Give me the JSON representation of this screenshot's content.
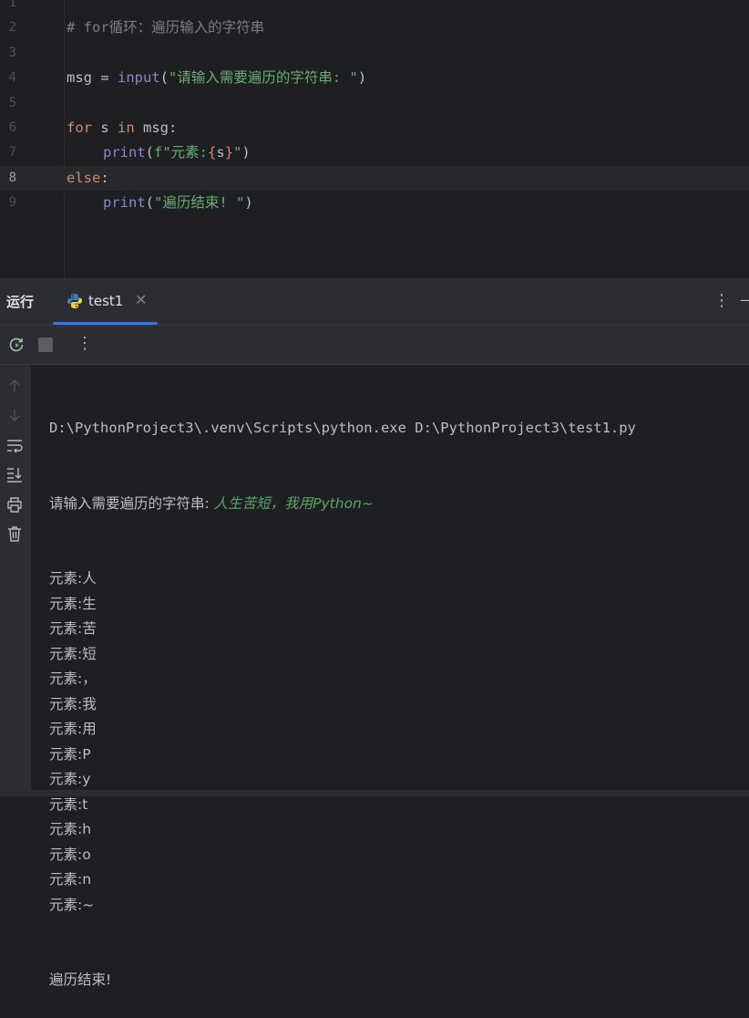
{
  "editor": {
    "lines": [
      {
        "num": "1",
        "tokens": []
      },
      {
        "num": "2",
        "tokens": [
          {
            "cls": "t-comment",
            "text": "# for循环：遍历输入的字符串"
          }
        ]
      },
      {
        "num": "3",
        "tokens": []
      },
      {
        "num": "4",
        "tokens": [
          {
            "cls": "t-plain",
            "text": "msg = "
          },
          {
            "cls": "t-builtin",
            "text": "input"
          },
          {
            "cls": "t-plain",
            "text": "("
          },
          {
            "cls": "t-str",
            "text": "\"请输入需要遍历的字符串: \""
          },
          {
            "cls": "t-plain",
            "text": ")"
          }
        ]
      },
      {
        "num": "5",
        "tokens": []
      },
      {
        "num": "6",
        "tokens": [
          {
            "cls": "t-kw",
            "text": "for"
          },
          {
            "cls": "t-plain",
            "text": " s "
          },
          {
            "cls": "t-kw",
            "text": "in"
          },
          {
            "cls": "t-plain",
            "text": " msg:"
          }
        ]
      },
      {
        "num": "7",
        "indent": true,
        "tokens": [
          {
            "cls": "t-builtin",
            "text": "print"
          },
          {
            "cls": "t-plain",
            "text": "("
          },
          {
            "cls": "t-str",
            "text": "f\"元素:"
          },
          {
            "cls": "t-brace",
            "text": "{"
          },
          {
            "cls": "t-plain",
            "text": "s"
          },
          {
            "cls": "t-brace",
            "text": "}"
          },
          {
            "cls": "t-str",
            "text": "\""
          },
          {
            "cls": "t-plain",
            "text": ")"
          }
        ]
      },
      {
        "num": "8",
        "current": true,
        "tokens": [
          {
            "cls": "t-kw",
            "text": "else"
          },
          {
            "cls": "t-plain",
            "text": ":"
          }
        ]
      },
      {
        "num": "9",
        "indent": true,
        "tokens": [
          {
            "cls": "t-builtin",
            "text": "print"
          },
          {
            "cls": "t-plain",
            "text": "("
          },
          {
            "cls": "t-str",
            "text": "\"遍历结束! \""
          },
          {
            "cls": "t-plain",
            "text": ")"
          }
        ]
      }
    ]
  },
  "run_panel": {
    "title": "运行",
    "tab_label": "test1",
    "tab_close": "✕",
    "more": "⋮",
    "minimize": "—"
  },
  "toolbar": {
    "more": "⋮"
  },
  "icons": {
    "rerun": "rerun-icon",
    "stop": "stop-icon",
    "scroll_up": "arrow-up-icon",
    "scroll_down": "arrow-down-icon",
    "soft_wrap": "soft-wrap-icon",
    "scroll_to_end": "scroll-to-end-icon",
    "print": "print-icon",
    "clear": "trash-icon"
  },
  "console": {
    "command": "D:\\PythonProject3\\.venv\\Scripts\\python.exe D:\\PythonProject3\\test1.py",
    "prompt": "请输入需要遍历的字符串: ",
    "user_input": "人生苦短，我用Python~",
    "outputs": [
      "元素:人",
      "元素:生",
      "元素:苦",
      "元素:短",
      "元素:，",
      "元素:我",
      "元素:用",
      "元素:P",
      "元素:y",
      "元素:t",
      "元素:h",
      "元素:o",
      "元素:n",
      "元素:~"
    ],
    "end": "遍历结束!"
  },
  "colors": {
    "background": "#1e1f22",
    "panel": "#2b2d30",
    "accent": "#3574f0",
    "keyword": "#cf8e6d",
    "string": "#6aab73",
    "builtin": "#8888c6",
    "comment": "#7a7e85"
  }
}
